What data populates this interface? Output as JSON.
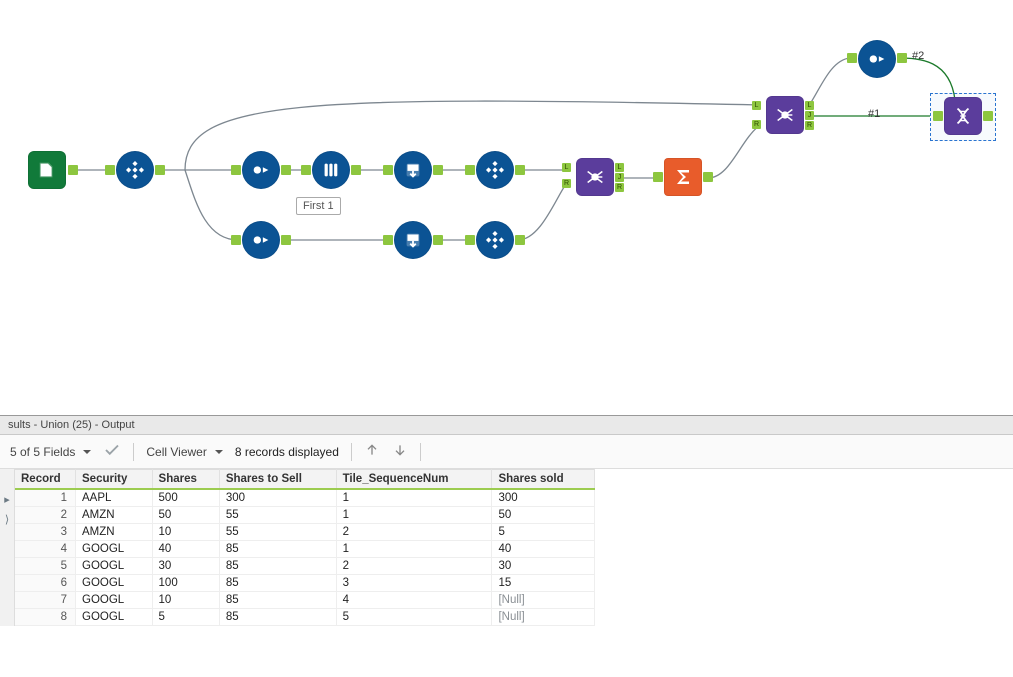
{
  "canvas": {
    "first_label": "First 1",
    "edge_labels": {
      "l1": "#1",
      "l2": "#2"
    }
  },
  "results": {
    "title": "sults - Union (25) - Output",
    "toolbar": {
      "fields_summary": "5 of 5 Fields",
      "cell_viewer": "Cell Viewer",
      "records_displayed": "8 records displayed"
    },
    "columns": [
      "Record",
      "Security",
      "Shares",
      "Shares to Sell",
      "Tile_SequenceNum",
      "Shares sold"
    ],
    "rows": [
      {
        "Record": "1",
        "Security": "AAPL",
        "Shares": "500",
        "Shares to Sell": "300",
        "Tile_SequenceNum": "1",
        "Shares sold": "300"
      },
      {
        "Record": "2",
        "Security": "AMZN",
        "Shares": "50",
        "Shares to Sell": "55",
        "Tile_SequenceNum": "1",
        "Shares sold": "50"
      },
      {
        "Record": "3",
        "Security": "AMZN",
        "Shares": "10",
        "Shares to Sell": "55",
        "Tile_SequenceNum": "2",
        "Shares sold": "5"
      },
      {
        "Record": "4",
        "Security": "GOOGL",
        "Shares": "40",
        "Shares to Sell": "85",
        "Tile_SequenceNum": "1",
        "Shares sold": "40"
      },
      {
        "Record": "5",
        "Security": "GOOGL",
        "Shares": "30",
        "Shares to Sell": "85",
        "Tile_SequenceNum": "2",
        "Shares sold": "30"
      },
      {
        "Record": "6",
        "Security": "GOOGL",
        "Shares": "100",
        "Shares to Sell": "85",
        "Tile_SequenceNum": "3",
        "Shares sold": "15"
      },
      {
        "Record": "7",
        "Security": "GOOGL",
        "Shares": "10",
        "Shares to Sell": "85",
        "Tile_SequenceNum": "4",
        "Shares sold": "[Null]"
      },
      {
        "Record": "8",
        "Security": "GOOGL",
        "Shares": "5",
        "Shares to Sell": "85",
        "Tile_SequenceNum": "5",
        "Shares sold": "[Null]"
      }
    ]
  }
}
